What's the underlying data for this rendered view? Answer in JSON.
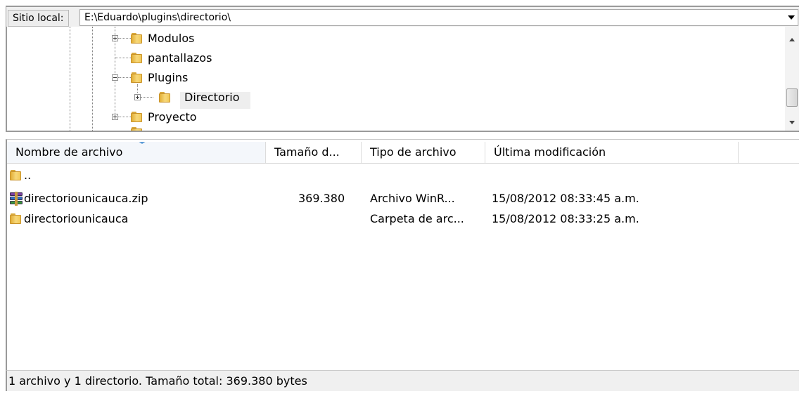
{
  "local_site": {
    "label": "Sitio local:",
    "path": "E:\\Eduardo\\plugins\\directorio\\"
  },
  "tree": {
    "items": [
      {
        "label": "Modulos",
        "expander": "plus"
      },
      {
        "label": "pantallazos",
        "expander": "none"
      },
      {
        "label": "Plugins",
        "expander": "minus"
      },
      {
        "label": "Directorio",
        "expander": "plus",
        "selected": true
      },
      {
        "label": "Proyecto",
        "expander": "plus"
      }
    ]
  },
  "file_list": {
    "columns": [
      "Nombre de archivo",
      "Tamaño d...",
      "Tipo de archivo",
      "Última modificación"
    ],
    "sorted_by": "Nombre de archivo",
    "rows": [
      {
        "name": "..",
        "size": "",
        "type": "",
        "modified": "",
        "icon": "folder-icon"
      },
      {
        "name": "directoriounicauca.zip",
        "size": "369.380",
        "type": "Archivo WinR...",
        "modified": "15/08/2012 08:33:45 a.m.",
        "icon": "winrar-archive-icon"
      },
      {
        "name": "directoriounicauca",
        "size": "",
        "type": "Carpeta de arc...",
        "modified": "15/08/2012 08:33:25 a.m.",
        "icon": "folder-icon"
      }
    ]
  },
  "status": {
    "text": "1 archivo y 1 directorio. Tamaño total: 369.380 bytes"
  }
}
